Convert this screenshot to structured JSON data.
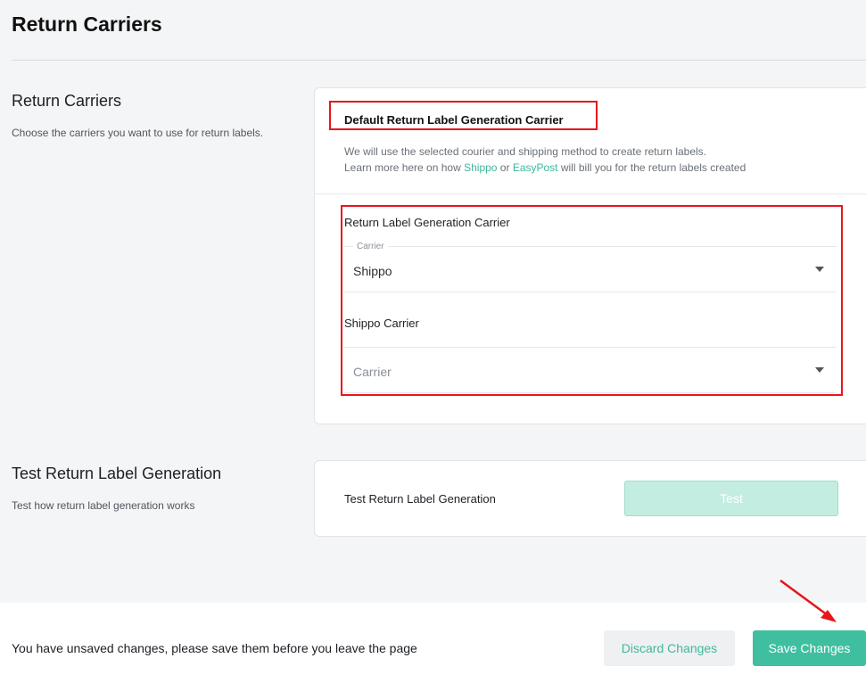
{
  "header": {
    "title": "Return Carriers"
  },
  "carriers_section": {
    "title": "Return Carriers",
    "description": "Choose the carriers you want to use for return labels.",
    "card": {
      "heading": "Default Return Label Generation Carrier",
      "desc_line1": "We will use the selected courier and shipping method to create return labels.",
      "desc_line2_prefix": "Learn more here on how ",
      "link_shippo": "Shippo",
      "desc_or": " or ",
      "link_easypost": "EasyPost",
      "desc_line2_suffix": " will bill you for the return labels created",
      "carrier_field": {
        "label": "Return Label Generation Carrier",
        "legend": "Carrier",
        "value": "Shippo"
      },
      "shippo_field": {
        "label": "Shippo Carrier",
        "placeholder": "Carrier"
      }
    }
  },
  "test_section": {
    "title": "Test Return Label Generation",
    "description": "Test how return label generation works",
    "card_label": "Test Return Label Generation",
    "button_label": "Test"
  },
  "footer": {
    "message": "You have unsaved changes, please save them before you leave the page",
    "discard_label": "Discard Changes",
    "save_label": "Save Changes"
  },
  "colors": {
    "accent": "#3fbf9f",
    "highlight": "#e8151b"
  }
}
